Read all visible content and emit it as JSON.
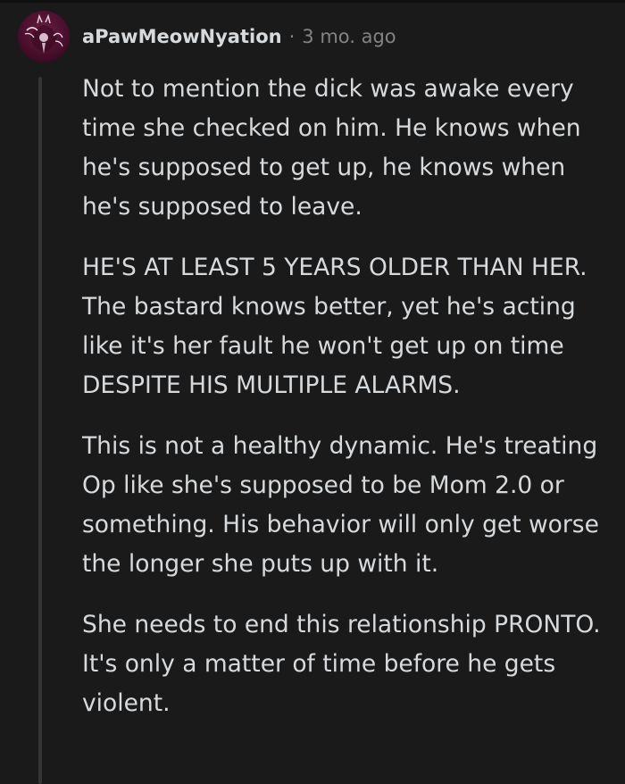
{
  "comment": {
    "username": "aPawMeowNyation",
    "separator": "·",
    "timestamp": "3 mo. ago",
    "avatar_icon": "cat-girl-avatar-icon",
    "paragraphs": [
      "Not to mention the dick was awake every time she checked on him. He knows when he's supposed to get up, he knows when he's supposed to leave.",
      "HE'S AT LEAST 5 YEARS OLDER THAN HER. The bastard knows better, yet he's acting like it's her fault he won't get up on time DESPITE HIS MULTIPLE ALARMS.",
      "This is not a healthy dynamic. He's treating Op like she's supposed to be Mom 2.0 or something. His behavior will only get worse the longer she puts up with it.",
      "She needs to end this relationship PRONTO. It's only a matter of time before he gets violent."
    ]
  },
  "colors": {
    "background": "#1a1a1b",
    "text": "#d7dadc",
    "muted": "#818384",
    "thread_line": "#343536"
  }
}
